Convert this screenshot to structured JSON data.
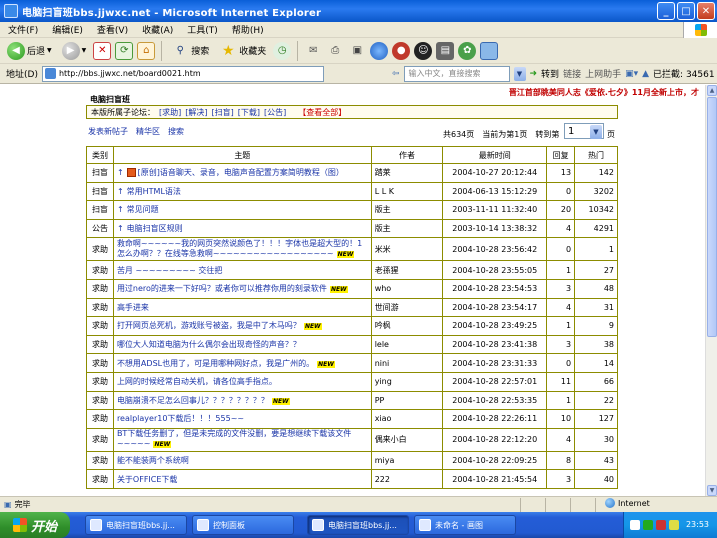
{
  "window": {
    "title": "电脑扫盲班bbs.jjwxc.net - Microsoft Internet Explorer"
  },
  "menu": [
    "文件(F)",
    "编辑(E)",
    "查看(V)",
    "收藏(A)",
    "工具(T)",
    "帮助(H)"
  ],
  "toolbar": {
    "back": "后退",
    "search": "搜索",
    "favorites": "收藏夹"
  },
  "address": {
    "label": "地址(D)",
    "url": "http://bbs.jjwxc.net/board0021.htm",
    "hint": "输入中文，直接搜索",
    "go": "转到",
    "links": "链接",
    "helper": "上网助手",
    "blocked": "已拦截: 34561"
  },
  "page": {
    "marquee": "晋江首部眺美同人志《爱依.七夕》11月全新上市，才",
    "board_title": "电脑扫盲班",
    "notice_prefix": "本版所属子论坛：",
    "notice_links": [
      "[求助]",
      "[解决]",
      "[扫盲]",
      "[下载]",
      "[公告]"
    ],
    "notice_all": "【查看全部】",
    "links": [
      "发表新帖子",
      "精华区",
      "搜索"
    ],
    "pager": {
      "total": "共634页",
      "current": "当前为第1页",
      "goto": "转到第",
      "page_value": "1",
      "suffix": "页"
    }
  },
  "table": {
    "headers": [
      "类别",
      "主题",
      "作者",
      "最新时间",
      "回复",
      "热门"
    ],
    "rows": [
      {
        "type": "扫盲",
        "title": "[原创]语音聊天、录音，电脑声音配置方案简明教程（图）",
        "author": "踏莱",
        "time": "2004-10-27 20:12:44",
        "replies": "13",
        "hot": "142",
        "pinned": true,
        "flag": true,
        "new": false
      },
      {
        "type": "扫盲",
        "title": "常用HTML语法",
        "author": "L L K",
        "time": "2004-06-13 15:12:29",
        "replies": "0",
        "hot": "3202",
        "pinned": true,
        "flag": false,
        "new": false
      },
      {
        "type": "扫盲",
        "title": "常见问题",
        "author": "版主",
        "time": "2003-11-11 11:32:40",
        "replies": "20",
        "hot": "10342",
        "pinned": true,
        "flag": false,
        "new": false
      },
      {
        "type": "公告",
        "title": "电脑扫盲区规则",
        "author": "版主",
        "time": "2003-10-14 13:38:32",
        "replies": "4",
        "hot": "4291",
        "pinned": true,
        "flag": false,
        "new": false
      },
      {
        "type": "求助",
        "title": "救命啊~~~~~~我的网页突然说颜色了！！！字体也是超大型的！1怎么办啊？？在线等急救啊~~~~~~~~~~~~~~~~~~",
        "author": "米米",
        "time": "2004-10-28 23:56:42",
        "replies": "0",
        "hot": "1",
        "pinned": false,
        "flag": false,
        "new": true,
        "tall": true
      },
      {
        "type": "求助",
        "title": "苦月 ~~~~~~~~~ 交往把",
        "author": "老孫猩",
        "time": "2004-10-28 23:55:05",
        "replies": "1",
        "hot": "27",
        "pinned": false,
        "flag": false,
        "new": false
      },
      {
        "type": "求助",
        "title": "用过nero的进来一下好吗？或者你可以推荐你用的刻录软件",
        "author": "who",
        "time": "2004-10-28 23:54:53",
        "replies": "3",
        "hot": "48",
        "pinned": false,
        "flag": false,
        "new": true
      },
      {
        "type": "求助",
        "title": "高手进来",
        "author": "世间游",
        "time": "2004-10-28 23:54:17",
        "replies": "4",
        "hot": "31",
        "pinned": false,
        "flag": false,
        "new": false
      },
      {
        "type": "求助",
        "title": "打开网页总死机，游戏账号被盗，我是中了木马吗？",
        "author": "吟枫",
        "time": "2004-10-28 23:49:25",
        "replies": "1",
        "hot": "9",
        "pinned": false,
        "flag": false,
        "new": true
      },
      {
        "type": "求助",
        "title": "哪位大人知道电脑为什么偶尔会出现奇怪的声音？？",
        "author": "lele",
        "time": "2004-10-28 23:41:38",
        "replies": "3",
        "hot": "38",
        "pinned": false,
        "flag": false,
        "new": false
      },
      {
        "type": "求助",
        "title": "不想用ADSL也用了，可是用哪种网好点，我是广州的。",
        "author": "nini",
        "time": "2004-10-28 23:31:33",
        "replies": "0",
        "hot": "14",
        "pinned": false,
        "flag": false,
        "new": true
      },
      {
        "type": "求助",
        "title": "上网的时候经常自动关机，请各位高手指点。",
        "author": "ying",
        "time": "2004-10-28 22:57:01",
        "replies": "11",
        "hot": "66",
        "pinned": false,
        "flag": false,
        "new": false
      },
      {
        "type": "求助",
        "title": "电脑崩溃不足怎么回事儿？？？？？？？？",
        "author": "PP",
        "time": "2004-10-28 22:53:35",
        "replies": "1",
        "hot": "22",
        "pinned": false,
        "flag": false,
        "new": true
      },
      {
        "type": "求助",
        "title": "realplayer10下载后！！！555~~",
        "author": "xiao",
        "time": "2004-10-28 22:26:11",
        "replies": "10",
        "hot": "127",
        "pinned": false,
        "flag": false,
        "new": false
      },
      {
        "type": "求助",
        "title": "BT下载任务删了，但是未完成的文件没删，要是想继续下载该文件~~~~~",
        "author": "偶来小白",
        "time": "2004-10-28 22:12:20",
        "replies": "4",
        "hot": "30",
        "pinned": false,
        "flag": false,
        "new": true,
        "tall": true
      },
      {
        "type": "求助",
        "title": "能不能装两个系统啊",
        "author": "miya",
        "time": "2004-10-28 22:09:25",
        "replies": "8",
        "hot": "43",
        "pinned": false,
        "flag": false,
        "new": false
      },
      {
        "type": "求助",
        "title": "关于OFFICE下载",
        "author": "222",
        "time": "2004-10-28 21:45:54",
        "replies": "3",
        "hot": "40",
        "pinned": false,
        "flag": false,
        "new": false
      }
    ]
  },
  "status": {
    "left": "完毕",
    "zone": "Internet"
  },
  "taskbar": {
    "start": "开始",
    "tasks": [
      "电脑扫盲班bbs.jj...",
      "控制面板",
      "电脑扫盲班bbs.jj...",
      "未命名 - 画图"
    ],
    "clock": "23:53"
  }
}
